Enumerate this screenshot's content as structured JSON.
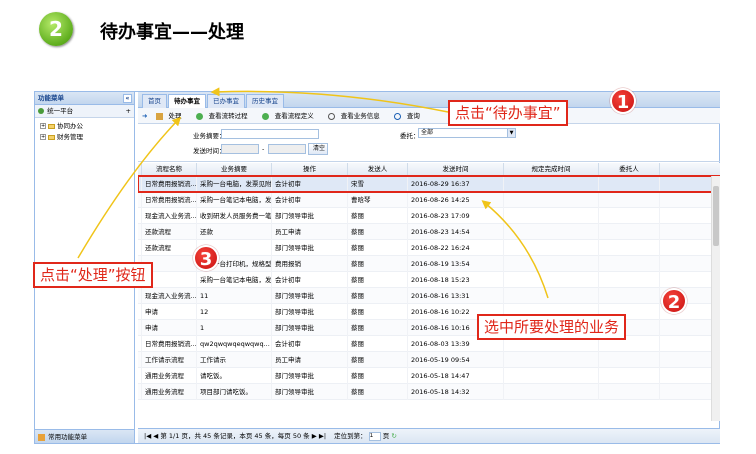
{
  "header": {
    "step_number": "2",
    "title": "待办事宜——处理"
  },
  "sidebar": {
    "title": "功能菜单",
    "collapse_icon": "«",
    "platform": "统一平台",
    "tree": [
      {
        "expander": "+",
        "label": "协同办公"
      },
      {
        "expander": "+",
        "label": "财务管理"
      }
    ],
    "footer": "常用功能菜单"
  },
  "tabs": [
    {
      "label": "首页",
      "active": false
    },
    {
      "label": "待办事宜",
      "active": true
    },
    {
      "label": "已办事宜",
      "active": false
    },
    {
      "label": "历史事宜",
      "active": false
    }
  ],
  "toolbar": {
    "process": "处理",
    "view_flow": "查看流转过程",
    "view_definition": "查看流程定义",
    "view_business": "查看业务信息",
    "query": "查询"
  },
  "form": {
    "summary_label": "业务摘要：",
    "summary_value": "",
    "time_label": "发送时间：",
    "time_sep": "-",
    "clear_button": "清空",
    "delegate_label": "委托：",
    "delegate_value": "全部"
  },
  "grid": {
    "columns": [
      "流程名称",
      "业务摘要",
      "操作",
      "发送人",
      "发送时间",
      "规定完成时间",
      "委托人"
    ],
    "rows": [
      [
        "日常费用报销流...",
        "采购一台电脑，发票见附...",
        "会计初审",
        "宋雪",
        "2016-08-29 16:37",
        "",
        ""
      ],
      [
        "日常费用报销流...",
        "采购一台笔记本电脑，发...",
        "会计初审",
        "曹晗琴",
        "2016-08-26 14:25",
        "",
        ""
      ],
      [
        "现金流入业务流...",
        "收到研发人员服务费一笔",
        "部门领导审批",
        "蔡丽",
        "2016-08-23 17:09",
        "",
        ""
      ],
      [
        "还款流程",
        "还款",
        "员工申请",
        "蔡丽",
        "2016-08-23 14:54",
        "",
        ""
      ],
      [
        "还款流程",
        "",
        "部门领导审批",
        "蔡丽",
        "2016-08-22 16:24",
        "",
        ""
      ],
      [
        "",
        "采购一台打印机，规格型...",
        "费用报销",
        "蔡丽",
        "2016-08-19 13:54",
        "",
        ""
      ],
      [
        "",
        "采购一台笔记本电脑，发...",
        "会计初审",
        "蔡丽",
        "2016-08-18 15:23",
        "",
        ""
      ],
      [
        "现金流入业务流...",
        "11",
        "部门领导审批",
        "蔡丽",
        "2016-08-16 13:31",
        "",
        ""
      ],
      [
        "申请",
        "12",
        "部门领导审批",
        "蔡丽",
        "2016-08-16 10:22",
        "",
        ""
      ],
      [
        "申请",
        "1",
        "部门领导审批",
        "蔡丽",
        "2016-08-16 10:16",
        "",
        ""
      ],
      [
        "日常费用报销流...",
        "qw2qwqwqeqwqwq...",
        "会计初审",
        "蔡丽",
        "2016-08-03 13:39",
        "",
        ""
      ],
      [
        "工作请示流程",
        "工作请示",
        "员工申请",
        "蔡丽",
        "2016-05-19 09:54",
        "",
        ""
      ],
      [
        "通用业务流程",
        "请吃饭。",
        "部门领导审批",
        "蔡丽",
        "2016-05-18 14:47",
        "",
        ""
      ],
      [
        "通用业务流程",
        "项目部门请吃饭。",
        "部门领导审批",
        "蔡丽",
        "2016-05-18 14:32",
        "",
        ""
      ]
    ],
    "selected_row": 0
  },
  "pager": {
    "first": "|◀",
    "prev": "◀",
    "page_info": "第 1/1 页，共 45 条记录，本页 45 条，每页 50 条",
    "next": "▶",
    "last": "▶|",
    "goto_label": "定位到第：",
    "goto_value": "1",
    "goto_unit": "页"
  },
  "callouts": [
    {
      "number": "1",
      "text": "点击“待办事宜”"
    },
    {
      "number": "2",
      "text": "选中所要处理的业务"
    },
    {
      "number": "3",
      "text": "点击“处理”按钮"
    }
  ],
  "colors": {
    "accent_red": "#e0271a",
    "badge_green": "#5fae1e",
    "ext_blue": "#99bbe8"
  }
}
